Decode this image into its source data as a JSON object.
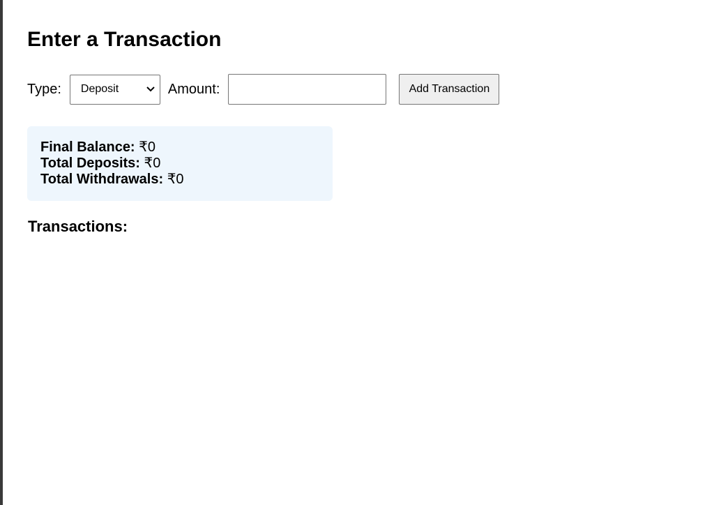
{
  "page": {
    "title": "Enter a Transaction"
  },
  "form": {
    "type_label": "Type:",
    "type_selected": "Deposit",
    "amount_label": "Amount:",
    "amount_value": "",
    "amount_placeholder": "",
    "submit_label": "Add Transaction"
  },
  "summary": {
    "final_balance_label": "Final Balance:",
    "final_balance_value": "₹0",
    "total_deposits_label": "Total Deposits:",
    "total_deposits_value": "₹0",
    "total_withdrawals_label": "Total Withdrawals:",
    "total_withdrawals_value": "₹0",
    "background_color": "#eef6fd"
  },
  "transactions": {
    "heading": "Transactions:",
    "items": []
  },
  "icons": {
    "select_arrow": "chevron-down-icon"
  }
}
